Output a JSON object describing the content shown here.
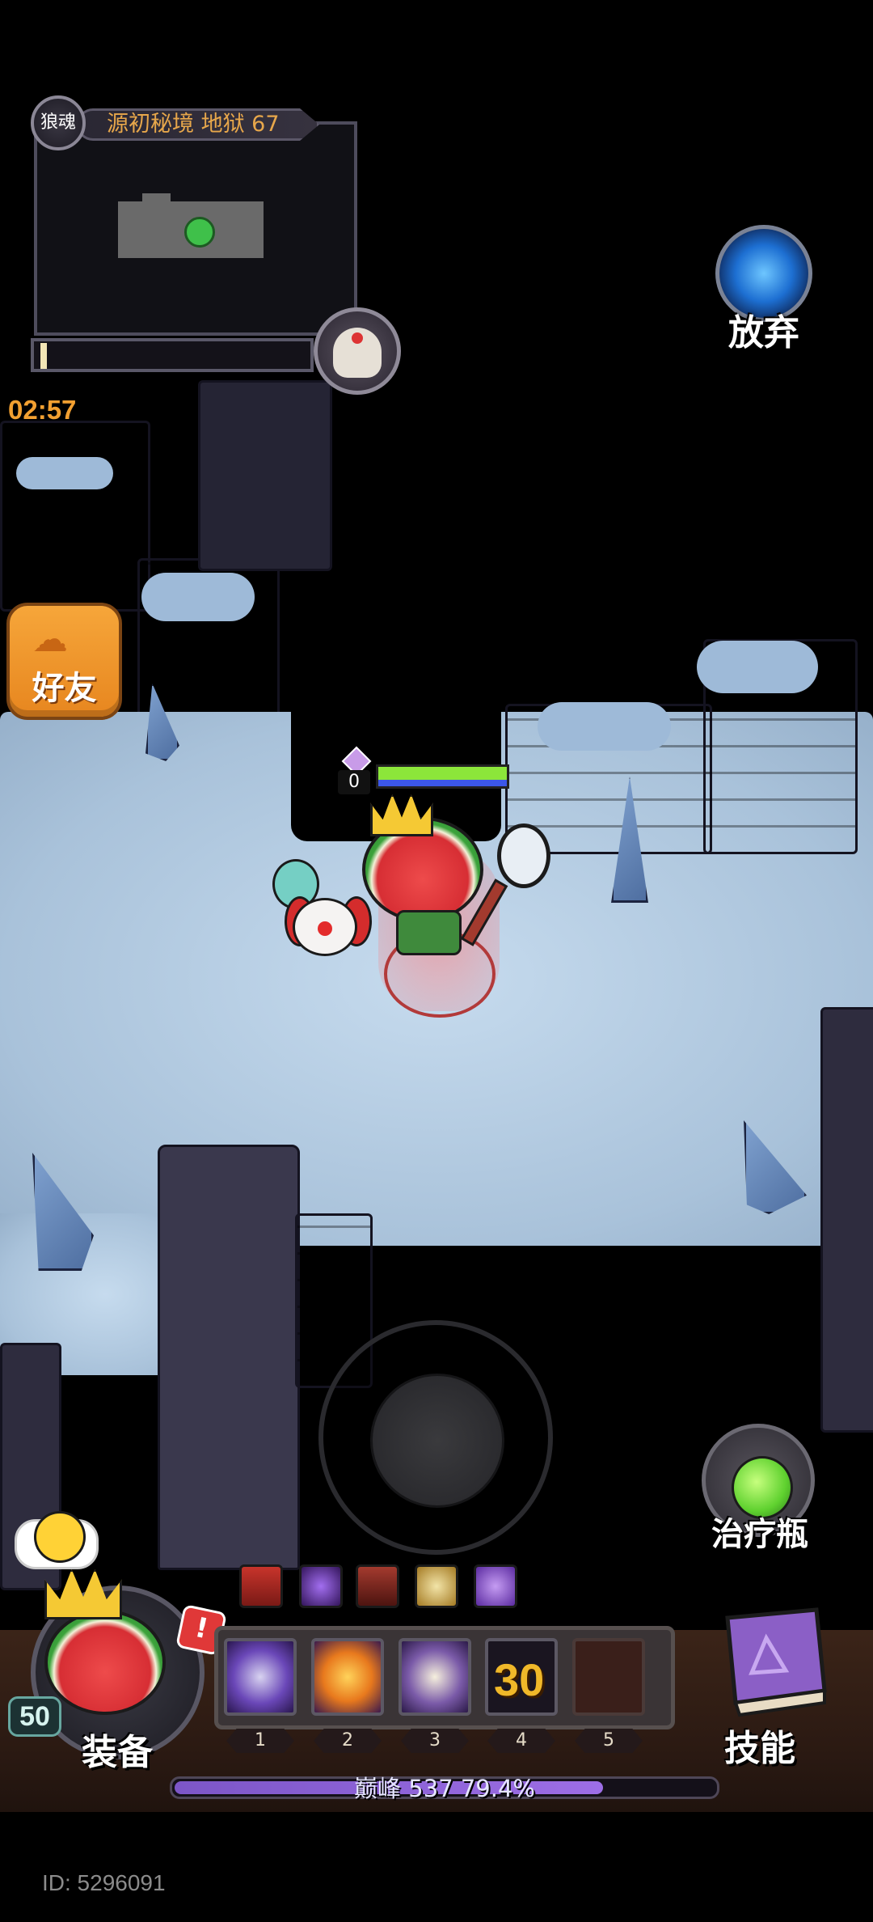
{
  "hud": {
    "faction_badge": "狼魂",
    "stage_title": "源初秘境 地狱 67",
    "timer": "02:57",
    "abandon_label": "放弃",
    "friends_label": "好友",
    "potion_label": "治疗瓶"
  },
  "player": {
    "gem_count": "0",
    "hp_fraction": 1.0,
    "mp_fraction": 1.0
  },
  "bottom": {
    "equip_label": "装备",
    "level": "50",
    "alert": "!",
    "skills_label": "技能",
    "skill_slots": [
      {
        "num": "1",
        "icon": "comet-skill-icon",
        "value": ""
      },
      {
        "num": "2",
        "icon": "fireball-skill-icon",
        "value": ""
      },
      {
        "num": "3",
        "icon": "shell-skill-icon",
        "value": ""
      },
      {
        "num": "4",
        "icon": "cooldown-slot",
        "value": "30"
      },
      {
        "num": "5",
        "icon": "empty-slot",
        "value": ""
      }
    ],
    "buffs": [
      "red-buff-icon",
      "purple-gem-buff-icon",
      "gear-buff-icon",
      "helmet-buff-icon",
      "arrow-up-buff-icon"
    ],
    "xp_text": "巅峰 537  79.4%",
    "xp_fraction": 0.794,
    "player_id": "ID: 5296091"
  },
  "colors": {
    "accent_orange": "#f2a031",
    "hp_green": "#8ce63a",
    "mp_blue": "#3c57e8",
    "xp_purple": "#8a5fd6",
    "floor": "#b8cfe4"
  }
}
